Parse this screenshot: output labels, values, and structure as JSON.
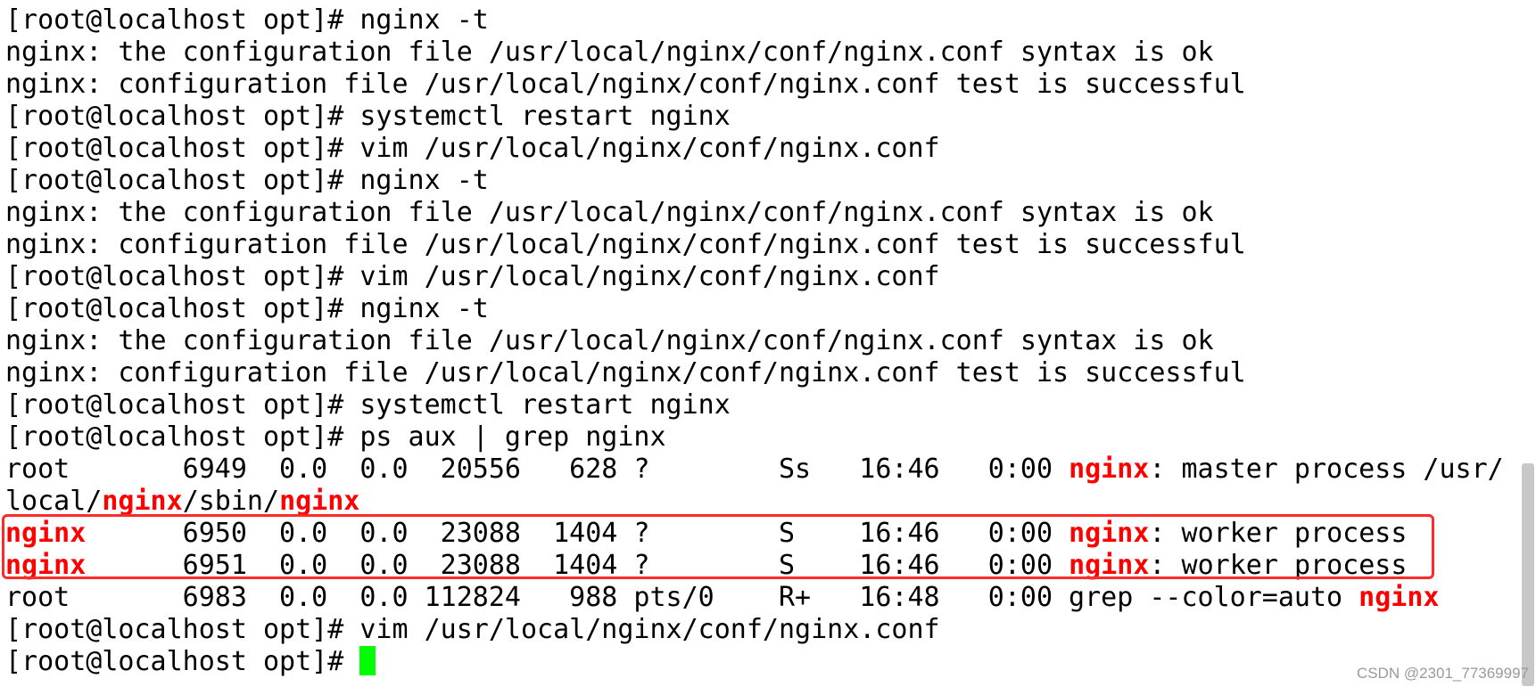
{
  "terminal": {
    "lines": [
      [
        {
          "t": "[root@localhost opt]# nginx -t"
        }
      ],
      [
        {
          "t": "nginx: the configuration file /usr/local/nginx/conf/nginx.conf syntax is ok"
        }
      ],
      [
        {
          "t": "nginx: configuration file /usr/local/nginx/conf/nginx.conf test is successful"
        }
      ],
      [
        {
          "t": "[root@localhost opt]# systemctl restart nginx"
        }
      ],
      [
        {
          "t": "[root@localhost opt]# vim /usr/local/nginx/conf/nginx.conf"
        }
      ],
      [
        {
          "t": "[root@localhost opt]# nginx -t"
        }
      ],
      [
        {
          "t": "nginx: the configuration file /usr/local/nginx/conf/nginx.conf syntax is ok"
        }
      ],
      [
        {
          "t": "nginx: configuration file /usr/local/nginx/conf/nginx.conf test is successful"
        }
      ],
      [
        {
          "t": "[root@localhost opt]# vim /usr/local/nginx/conf/nginx.conf"
        }
      ],
      [
        {
          "t": "[root@localhost opt]# nginx -t"
        }
      ],
      [
        {
          "t": "nginx: the configuration file /usr/local/nginx/conf/nginx.conf syntax is ok"
        }
      ],
      [
        {
          "t": "nginx: configuration file /usr/local/nginx/conf/nginx.conf test is successful"
        }
      ],
      [
        {
          "t": "[root@localhost opt]# systemctl restart nginx"
        }
      ],
      [
        {
          "t": "[root@localhost opt]# ps aux | grep nginx"
        }
      ],
      [
        {
          "t": "root       6949  0.0  0.0  20556   628 ?        Ss   16:46   0:00 "
        },
        {
          "t": "nginx",
          "hl": true
        },
        {
          "t": ": master process /usr/"
        }
      ],
      [
        {
          "t": "local/"
        },
        {
          "t": "nginx",
          "hl": true
        },
        {
          "t": "/sbin/"
        },
        {
          "t": "nginx",
          "hl": true
        }
      ],
      [
        {
          "t": "nginx",
          "hl": true
        },
        {
          "t": "      6950  0.0  0.0  23088  1404 ?        S    16:46   0:00 "
        },
        {
          "t": "nginx",
          "hl": true
        },
        {
          "t": ": worker process"
        }
      ],
      [
        {
          "t": "nginx",
          "hl": true
        },
        {
          "t": "      6951  0.0  0.0  23088  1404 ?        S    16:46   0:00 "
        },
        {
          "t": "nginx",
          "hl": true
        },
        {
          "t": ": worker process"
        }
      ],
      [
        {
          "t": "root       6983  0.0  0.0 112824   988 pts/0    R+   16:48   0:00 grep --color=auto "
        },
        {
          "t": "nginx",
          "hl": true
        }
      ],
      [
        {
          "t": "[root@localhost opt]# vim /usr/local/nginx/conf/nginx.conf"
        }
      ],
      [
        {
          "t": "[root@localhost opt]# "
        },
        {
          "cursor": true
        }
      ]
    ],
    "colors": {
      "background": "#ffffff",
      "text": "#000000",
      "highlight": "#ff0000",
      "cursor": "#00ff00",
      "annotation_box": "#ff2a2a"
    }
  },
  "watermark": "CSDN @2301_77369997"
}
